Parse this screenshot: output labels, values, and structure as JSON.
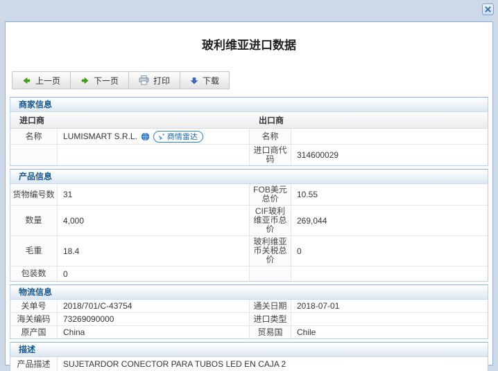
{
  "dialog": {
    "title": "玻利维亚进口数据"
  },
  "icons": {
    "close": "x-close",
    "prev": "green-arrow-left",
    "next": "green-arrow-right",
    "print": "printer",
    "download": "blue-arrow-down",
    "globe": "globe",
    "radar": "radar-dish"
  },
  "colors": {
    "frame_bg": "#cdd9e8",
    "panel_border": "#8fadd1",
    "section_header_text": "#15568d",
    "radar_blue": "#2f7fc1",
    "arrow_green": "#44a712",
    "arrow_blue": "#3b68c4"
  },
  "toolbar": {
    "prev": "上一页",
    "next": "下一页",
    "print": "打印",
    "download": "下载"
  },
  "merchant": {
    "header": "商家信息",
    "importer_header": "进口商",
    "exporter_header": "出口商",
    "name_label": "名称",
    "importer_name": "LUMISMART S.R.L.",
    "radar_badge": "商情雷达",
    "exp_name_label": "名称",
    "exp_name_value": "",
    "importer_code_label": "进口商代码",
    "importer_code_value": "314600029"
  },
  "product": {
    "header": "产品信息",
    "rows": [
      {
        "l_label": "货物编号数",
        "l_value": "31",
        "r_label": "FOB美元总价",
        "r_value": "10.55"
      },
      {
        "l_label": "数量",
        "l_value": "4,000",
        "r_label": "CIF玻利维亚币总价",
        "r_value": "269,044"
      },
      {
        "l_label": "毛重",
        "l_value": "18.4",
        "r_label": "玻利维亚币关税总价",
        "r_value": "0"
      },
      {
        "l_label": "包装数",
        "l_value": "0",
        "r_label": "",
        "r_value": ""
      }
    ]
  },
  "logistics": {
    "header": "物流信息",
    "rows": [
      {
        "l_label": "关单号",
        "l_value": "2018/701/C-43754",
        "r_label": "通关日期",
        "r_value": "2018-07-01"
      },
      {
        "l_label": "海关编码",
        "l_value": "73269090000",
        "r_label": "进口类型",
        "r_value": ""
      },
      {
        "l_label": "原产国",
        "l_value": "China",
        "r_label": "贸易国",
        "r_value": "Chile"
      }
    ]
  },
  "description": {
    "header": "描述",
    "label": "产品描述",
    "value": "SUJETARDOR CONECTOR PARA TUBOS LED EN CAJA 2"
  }
}
